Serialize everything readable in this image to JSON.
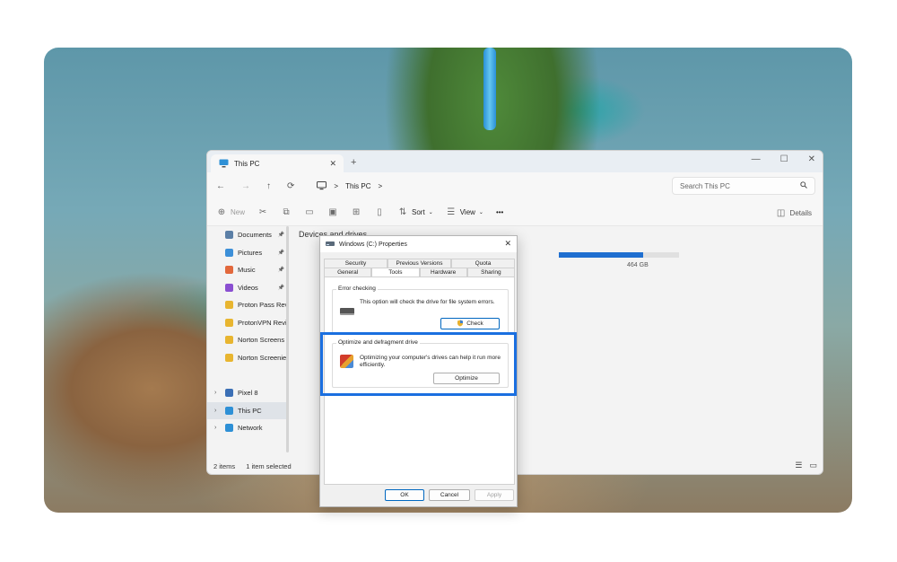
{
  "explorer": {
    "tab_title": "This PC",
    "tab_close": "✕",
    "new_tab": "+",
    "window_controls": [
      "—",
      "☐",
      "✕"
    ],
    "nav": {
      "back": "←",
      "forward": "→",
      "up": "↑",
      "refresh": "⟳"
    },
    "breadcrumb": {
      "sep": ">",
      "location": "This PC",
      "chev": ">"
    },
    "search_placeholder": "Search This PC",
    "toolbar": {
      "new_label": "New",
      "sort_label": "Sort",
      "view_label": "View",
      "more_label": "•••",
      "details_label": "Details"
    },
    "sidebar": [
      {
        "label": "Documents",
        "pinned": true,
        "color": "#5b7fa6"
      },
      {
        "label": "Pictures",
        "pinned": true,
        "color": "#3c8fd8"
      },
      {
        "label": "Music",
        "pinned": true,
        "color": "#e2683c"
      },
      {
        "label": "Videos",
        "pinned": true,
        "color": "#8a4fd1"
      },
      {
        "label": "Proton Pass Rev",
        "pinned": false,
        "color": "#e8b530"
      },
      {
        "label": "ProtonVPN Revi",
        "pinned": false,
        "color": "#e8b530"
      },
      {
        "label": "Norton Screens",
        "pinned": false,
        "color": "#e8b530"
      },
      {
        "label": "Norton Screenie",
        "pinned": false,
        "color": "#e8b530"
      },
      {
        "label": "Pixel 8",
        "expandable": true,
        "color": "#3b6fb5"
      },
      {
        "label": "This PC",
        "expandable": true,
        "selected": true,
        "color": "#2e90d6"
      },
      {
        "label": "Network",
        "expandable": true,
        "color": "#2e90d6"
      }
    ],
    "section_title": "Devices and drives",
    "drive_size": "464 GB",
    "drive_usage_fraction": 0.7,
    "status": {
      "items": "2 items",
      "selected": "1 item selected"
    }
  },
  "dialog": {
    "title": "Windows (C:) Properties",
    "close": "✕",
    "tabs_row1": [
      "Security",
      "Previous Versions",
      "Quota"
    ],
    "tabs_row2": [
      "General",
      "Tools",
      "Hardware",
      "Sharing"
    ],
    "active_tab": "Tools",
    "error_checking": {
      "label": "Error checking",
      "text": "This option will check the drive for file system errors.",
      "button": "Check"
    },
    "optimize": {
      "label": "Optimize and defragment drive",
      "text": "Optimizing your computer's drives can help it run more efficiently.",
      "button": "Optimize"
    },
    "footer": {
      "ok": "OK",
      "cancel": "Cancel",
      "apply": "Apply"
    }
  },
  "colors": {
    "accent": "#1a6fe0",
    "selected_bg": "#dfe3e8"
  }
}
